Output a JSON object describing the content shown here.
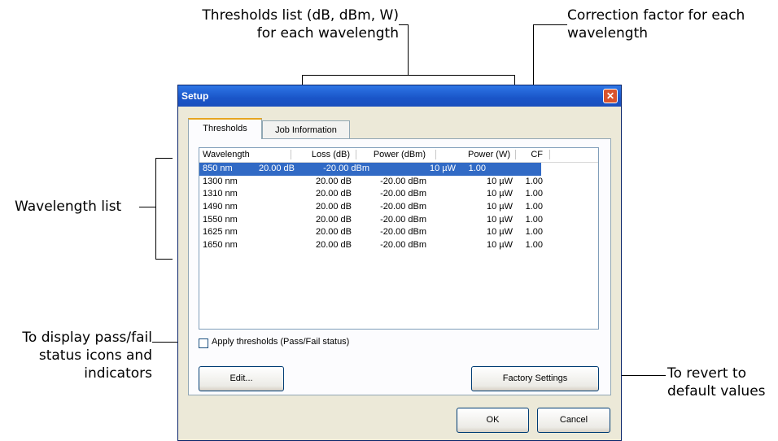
{
  "annotations": {
    "thresholds_list_line1": "Thresholds list (dB, dBm, W)",
    "thresholds_list_line2": "for each wavelength",
    "correction_factor_line1": "Correction factor for each",
    "correction_factor_line2": "wavelength",
    "wavelength_list": "Wavelength list",
    "pass_fail_line1": "To display pass/fail",
    "pass_fail_line2": "status icons and",
    "pass_fail_line3": "indicators",
    "revert_line1": "To revert to",
    "revert_line2": "default values"
  },
  "dialog": {
    "title": "Setup",
    "close_glyph": "✕",
    "tabs": [
      {
        "label": "Thresholds",
        "active": true
      },
      {
        "label": "Job Information",
        "active": false
      }
    ],
    "columns": [
      "Wavelength",
      "Loss (dB)",
      "Power (dBm)",
      "Power (W)",
      "CF"
    ],
    "rows": [
      {
        "wavelength": "850 nm",
        "loss": "20.00 dB",
        "power_dbm": "-20.00 dBm",
        "power_w": "10 µW",
        "cf": "1.00",
        "selected": true
      },
      {
        "wavelength": "1300 nm",
        "loss": "20.00 dB",
        "power_dbm": "-20.00 dBm",
        "power_w": "10 µW",
        "cf": "1.00"
      },
      {
        "wavelength": "1310 nm",
        "loss": "20.00 dB",
        "power_dbm": "-20.00 dBm",
        "power_w": "10 µW",
        "cf": "1.00"
      },
      {
        "wavelength": "1490 nm",
        "loss": "20.00 dB",
        "power_dbm": "-20.00 dBm",
        "power_w": "10 µW",
        "cf": "1.00"
      },
      {
        "wavelength": "1550 nm",
        "loss": "20.00 dB",
        "power_dbm": "-20.00 dBm",
        "power_w": "10 µW",
        "cf": "1.00"
      },
      {
        "wavelength": "1625 nm",
        "loss": "20.00 dB",
        "power_dbm": "-20.00 dBm",
        "power_w": "10 µW",
        "cf": "1.00"
      },
      {
        "wavelength": "1650 nm",
        "loss": "20.00 dB",
        "power_dbm": "-20.00 dBm",
        "power_w": "10 µW",
        "cf": "1.00"
      }
    ],
    "apply_thresholds_label": "Apply thresholds (Pass/Fail status)",
    "apply_thresholds_checked": false,
    "edit_button": "Edit...",
    "factory_settings_button": "Factory Settings",
    "ok_button": "OK",
    "cancel_button": "Cancel"
  },
  "colors": {
    "titlebar": "#2e76e6",
    "selection": "#316ac5",
    "tab_accent": "#e6a41e",
    "close_button": "#d9532c",
    "dialog_face": "#ece9d8"
  }
}
